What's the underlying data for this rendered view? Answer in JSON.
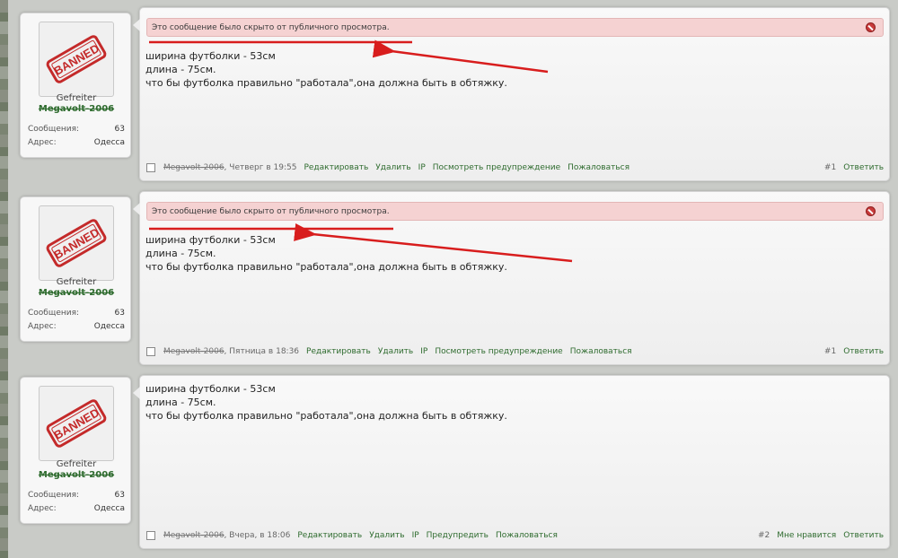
{
  "posts": [
    {
      "user": {
        "avatar_text": "BANNED",
        "title": "Gefreiter",
        "name": "Megavolt-2006",
        "messages_label": "Сообщения:",
        "messages_value": "63",
        "address_label": "Адрес:",
        "address_value": "Одесса"
      },
      "hidden_notice": "Это сообщение было скрыто от публичного просмотра.",
      "lines": [
        "ширина футболки - 53см",
        "длина - 75см.",
        "что бы футболка правильно \"работала\",она должна быть в обтяжку."
      ],
      "footer": {
        "author": "Megavolt-2006",
        "date": ", Четверг в 19:55",
        "links": [
          "Редактировать",
          "Удалить",
          "IP",
          "Посмотреть предупреждение",
          "Пожаловаться"
        ],
        "post_number": "#1",
        "right_links": [
          "Ответить"
        ]
      }
    },
    {
      "user": {
        "avatar_text": "BANNED",
        "title": "Gefreiter",
        "name": "Megavolt-2006",
        "messages_label": "Сообщения:",
        "messages_value": "63",
        "address_label": "Адрес:",
        "address_value": "Одесса"
      },
      "hidden_notice": "Это сообщение было скрыто от публичного просмотра.",
      "lines": [
        "ширина футболки - 53см",
        "длина - 75см.",
        "что бы футболка правильно \"работала\",она должна быть в обтяжку."
      ],
      "footer": {
        "author": "Megavolt-2006",
        "date": ", Пятница в 18:36",
        "links": [
          "Редактировать",
          "Удалить",
          "IP",
          "Посмотреть предупреждение",
          "Пожаловаться"
        ],
        "post_number": "#1",
        "right_links": [
          "Ответить"
        ]
      }
    },
    {
      "user": {
        "avatar_text": "BANNED",
        "title": "Gefreiter",
        "name": "Megavolt-2006",
        "messages_label": "Сообщения:",
        "messages_value": "63",
        "address_label": "Адрес:",
        "address_value": "Одесса"
      },
      "lines": [
        "ширина футболки - 53см",
        "длина - 75см.",
        "что бы футболка правильно \"работала\",она должна быть в обтяжку."
      ],
      "footer": {
        "author": "Megavolt-2006",
        "date": ", Вчера, в 18:06",
        "links": [
          "Редактировать",
          "Удалить",
          "IP",
          "Предупредить",
          "Пожаловаться"
        ],
        "post_number": "#2",
        "right_links": [
          "Мне нравится",
          "Ответить"
        ]
      }
    }
  ],
  "colors": {
    "link": "#2e6b2e",
    "notice_bg": "#f5d2d2",
    "annotation_arrow": "#d81d1d",
    "stamp": "#c42a2a"
  }
}
